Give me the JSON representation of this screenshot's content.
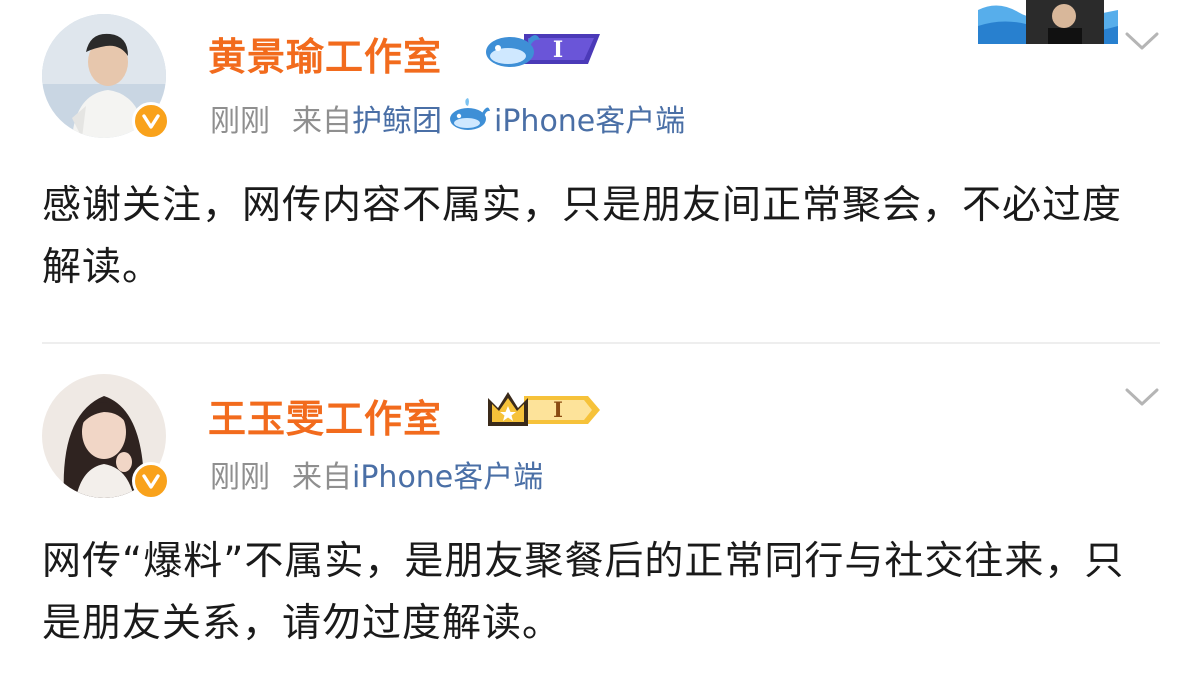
{
  "posts": [
    {
      "author": "黄景瑜工作室",
      "time": "刚刚",
      "source_prefix": "来自",
      "source_client": "护鲸团",
      "source_app": "iPhone客户端",
      "badge_level": "I",
      "content": "感谢关注，网传内容不属实，只是朋友间正常聚会，不必过度解读。"
    },
    {
      "author": "王玉雯工作室",
      "time": "刚刚",
      "source_prefix": "来自",
      "source_app": "iPhone客户端",
      "badge_level": "I",
      "content": "网传“爆料”不属实，是朋友聚餐后的正常同行与社交往来，只是朋友关系，请勿过度解读。"
    }
  ],
  "colors": {
    "name": "#f26b1d",
    "meta": "#8f8f8f",
    "link": "#4a6fa6",
    "verified": "#f9a21b",
    "divider": "#eeeeee"
  },
  "icons": {
    "verified": "verified-v-icon",
    "whale_badge": "whale-badge-icon",
    "crown_badge": "crown-badge-icon",
    "chevron": "chevron-down-icon"
  }
}
